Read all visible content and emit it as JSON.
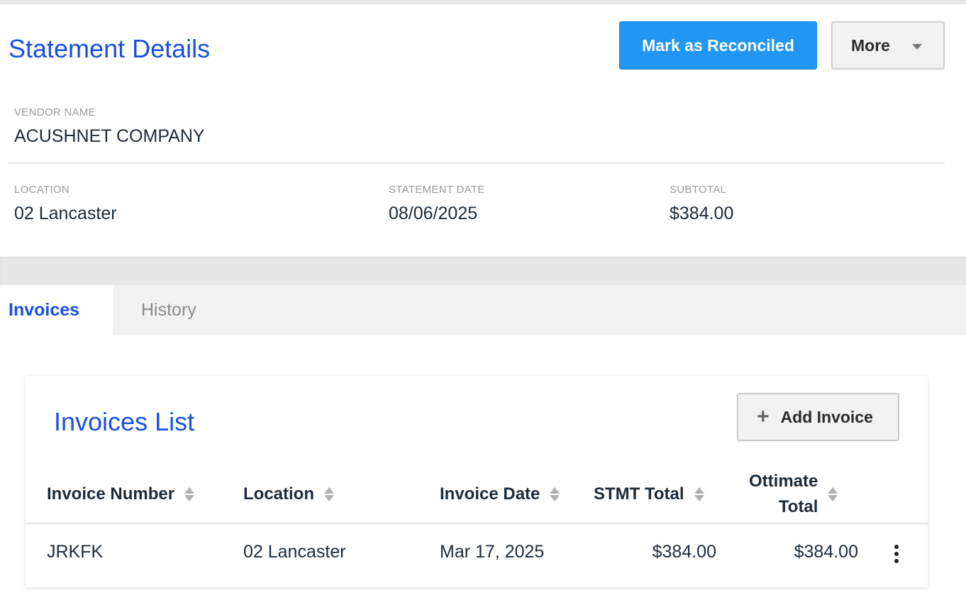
{
  "header": {
    "title": "Statement Details",
    "reconcile_label": "Mark as Reconciled",
    "more_label": "More"
  },
  "details": {
    "vendor_label": "VENDOR NAME",
    "vendor_value": "ACUSHNET COMPANY",
    "location_label": "LOCATION",
    "location_value": "02 Lancaster",
    "statement_date_label": "STATEMENT DATE",
    "statement_date_value": "08/06/2025",
    "subtotal_label": "SUBTOTAL",
    "subtotal_value": "$384.00"
  },
  "tabs": [
    {
      "label": "Invoices",
      "active": true
    },
    {
      "label": "History",
      "active": false
    }
  ],
  "invoices": {
    "title": "Invoices List",
    "add_label": "Add Invoice",
    "columns": {
      "invoice_number": "Invoice Number",
      "location": "Location",
      "invoice_date": "Invoice Date",
      "stmt_total": "STMT Total",
      "ottimate_total_line1": "Ottimate",
      "ottimate_total_line2": "Total"
    },
    "rows": [
      {
        "invoice_number": "JRKFK",
        "location": "02 Lancaster",
        "invoice_date": "Mar 17, 2025",
        "stmt_total": "$384.00",
        "ottimate_total": "$384.00"
      }
    ]
  },
  "colors": {
    "accent": "#1a4fe0",
    "primary_button": "#2196f3"
  }
}
